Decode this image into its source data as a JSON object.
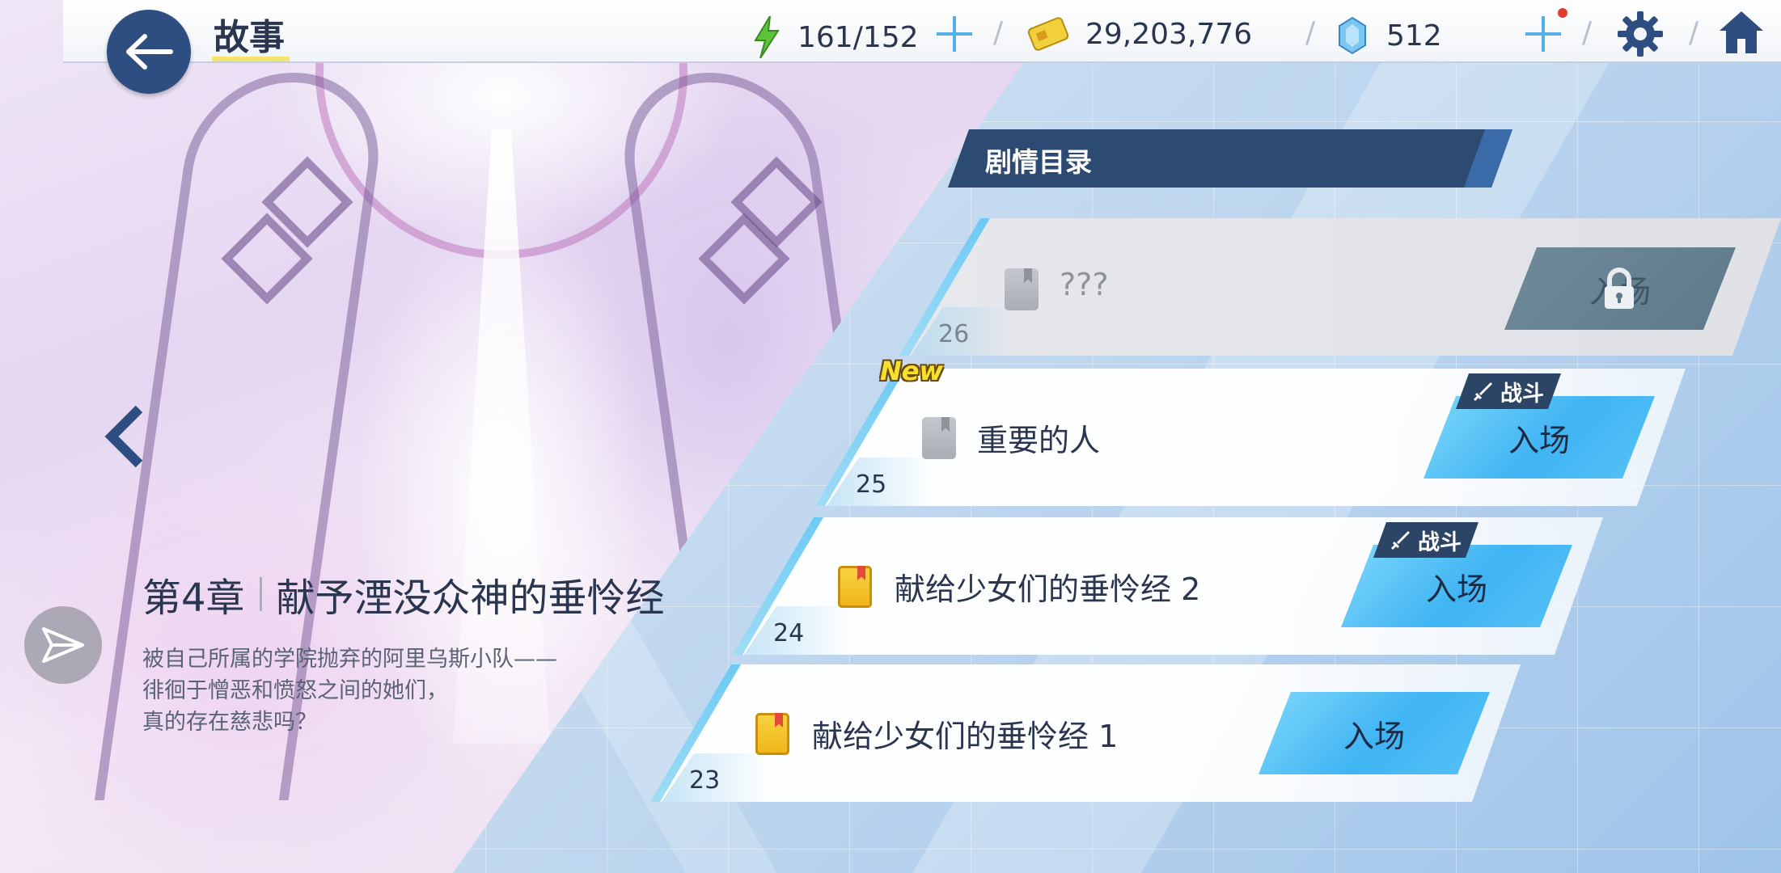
{
  "header": {
    "title": "故事",
    "stamina": "161/152",
    "credits": "29,203,776",
    "gems": "512"
  },
  "chapter": {
    "number": "第4章",
    "name": "献予湮没众神的垂怜经",
    "description": [
      "被自己所属的学院抛弃的阿里乌斯小队——",
      "徘徊于憎恶和愤怒之间的她们，",
      "真的存在慈悲吗？"
    ]
  },
  "list": {
    "header": "剧情目录",
    "episodes": [
      {
        "number": "26",
        "title": "???",
        "button": "入场",
        "locked": true
      },
      {
        "number": "25",
        "title": "重要的人",
        "button": "入场",
        "tag": "战斗",
        "badge": "New"
      },
      {
        "number": "24",
        "title": "献给少女们的垂怜经 2",
        "button": "入场",
        "tag": "战斗"
      },
      {
        "number": "23",
        "title": "献给少女们的垂怜经 1",
        "button": "入场"
      }
    ]
  },
  "colors": {
    "header_bg": "#2c4a72",
    "enter_button": "#3fb4f3",
    "back_button": "#2e4d80",
    "accent_plus": "#55aee8",
    "notification": "#e23b2f"
  },
  "icons": {
    "back": "arrow-left-icon",
    "stamina": "lightning-icon",
    "credits": "credit-card-icon",
    "gems": "crystal-icon",
    "settings": "gear-icon",
    "home": "home-icon",
    "prev": "chevron-left-icon",
    "share": "send-icon",
    "lock": "lock-icon",
    "battle": "sword-icon",
    "book": "book-icon"
  }
}
